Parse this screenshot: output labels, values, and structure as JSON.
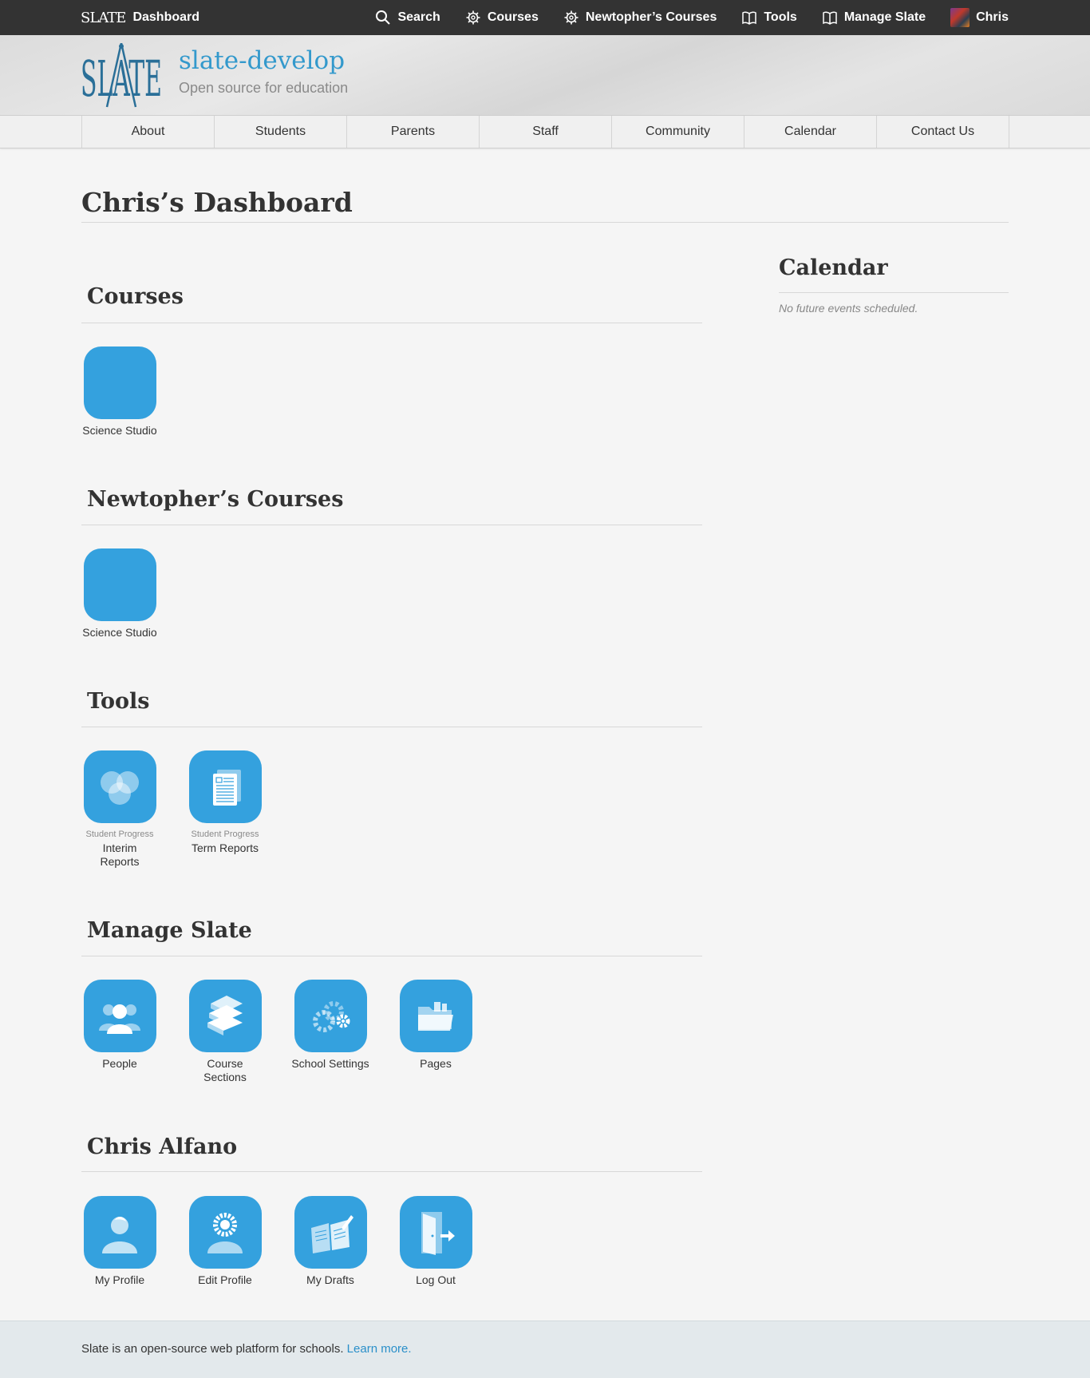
{
  "topbar": {
    "brand_logo": "SLATE",
    "brand_label": "Dashboard",
    "nav": [
      {
        "label": "Search",
        "icon": "search-icon"
      },
      {
        "label": "Courses",
        "icon": "gear-icon"
      },
      {
        "label": "Newtopher’s Courses",
        "icon": "gear-icon"
      },
      {
        "label": "Tools",
        "icon": "book-icon"
      },
      {
        "label": "Manage Slate",
        "icon": "book-icon"
      },
      {
        "label": "Chris",
        "icon": "avatar"
      }
    ]
  },
  "header": {
    "logo_text": "SLATE",
    "site_title": "slate-develop",
    "site_subtitle": "Open source for education"
  },
  "mainnav": [
    "About",
    "Students",
    "Parents",
    "Staff",
    "Community",
    "Calendar",
    "Contact Us"
  ],
  "page_title": "Chris’s Dashboard",
  "sections": {
    "courses": {
      "title": "Courses",
      "tiles": [
        {
          "label": "Science Studio",
          "icon": "blank-tile-icon"
        }
      ]
    },
    "newtopher": {
      "title": "Newtopher’s Courses",
      "tiles": [
        {
          "label": "Science Studio",
          "icon": "blank-tile-icon"
        }
      ]
    },
    "tools": {
      "title": "Tools",
      "tiles": [
        {
          "kicker": "Student Progress",
          "label": "Interim Reports",
          "icon": "venn-icon"
        },
        {
          "kicker": "Student Progress",
          "label": "Term Reports",
          "icon": "document-icon"
        }
      ]
    },
    "manage": {
      "title": "Manage Slate",
      "tiles": [
        {
          "label": "People",
          "icon": "people-icon"
        },
        {
          "label": "Course Sections",
          "icon": "books-icon"
        },
        {
          "label": "School Settings",
          "icon": "gears-icon"
        },
        {
          "label": "Pages",
          "icon": "folder-icon"
        }
      ]
    },
    "user": {
      "title": "Chris Alfano",
      "tiles": [
        {
          "label": "My Profile",
          "icon": "person-icon"
        },
        {
          "label": "Edit Profile",
          "icon": "person-gear-icon"
        },
        {
          "label": "My Drafts",
          "icon": "notebook-icon"
        },
        {
          "label": "Log Out",
          "icon": "door-icon"
        }
      ]
    }
  },
  "calendar": {
    "title": "Calendar",
    "empty_text": "No future events scheduled."
  },
  "footer": {
    "text": "Slate is an open-source web platform for schools.",
    "link": "Learn more."
  },
  "colors": {
    "accent": "#34a1de",
    "topbar": "#333333",
    "link": "#2a8fc9"
  }
}
